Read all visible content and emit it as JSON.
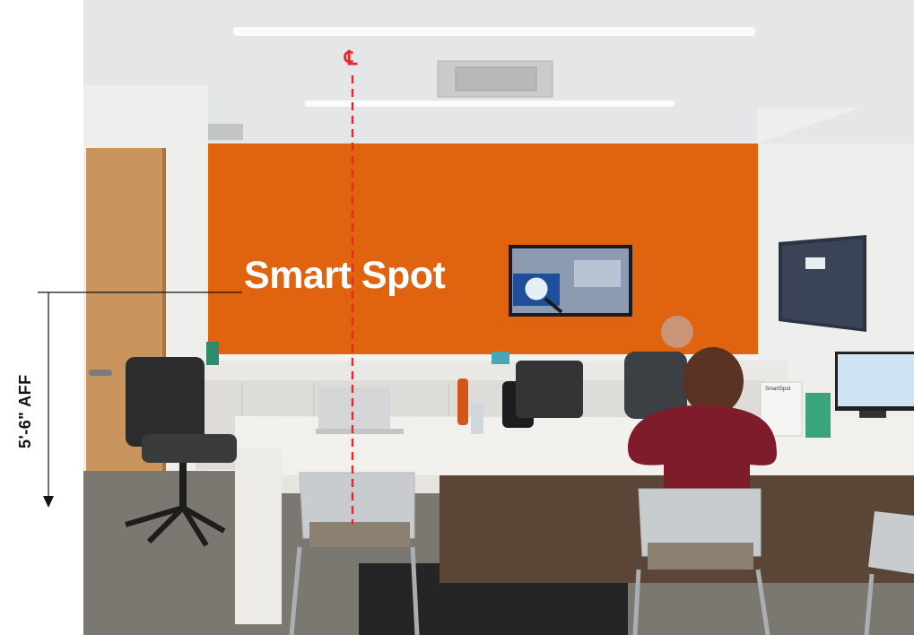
{
  "photo": {
    "subject": "office meeting room with orange accent wall",
    "sign_text": "Smart Spot",
    "colors": {
      "accent_wall": "#e0640f",
      "ceiling": "#e6e8ea",
      "wall": "#f2f2f1",
      "door": "#c9945e",
      "desk_top": "#f1f0ec",
      "desk_front": "#5b4536",
      "floor": "#7b7872",
      "rug": "#2b2a2a"
    }
  },
  "annotations": {
    "centerline_symbol": "℄",
    "dimension_label": "5'-6\" AFF",
    "line_color": "#e8262b"
  },
  "desk_card": {
    "text": "SmartSpot"
  }
}
